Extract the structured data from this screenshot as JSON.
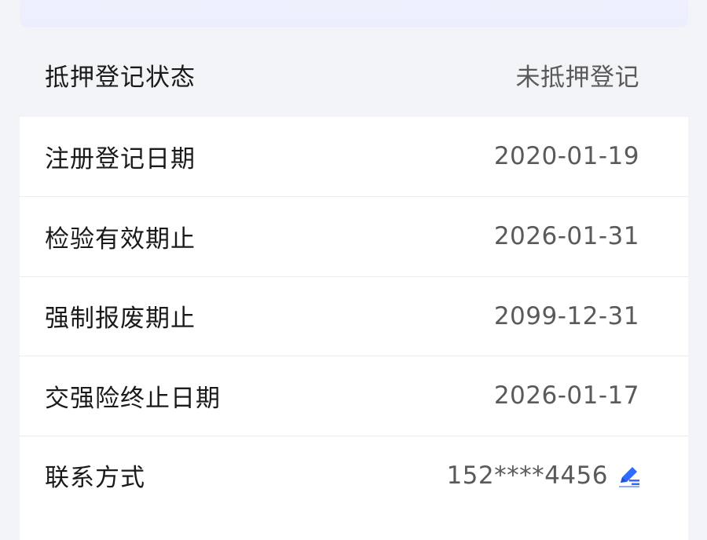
{
  "rows": [
    {
      "label": "抵押登记状态",
      "value": "未抵押登记"
    },
    {
      "label": "注册登记日期",
      "value": "2020-01-19"
    },
    {
      "label": "检验有效期止",
      "value": "2026-01-31"
    },
    {
      "label": "强制报废期止",
      "value": "2099-12-31"
    },
    {
      "label": "交强险终止日期",
      "value": "2026-01-17"
    },
    {
      "label": "联系方式",
      "value": "152****4456",
      "icon": "edit-icon"
    }
  ],
  "colors": {
    "accent": "#2f6bff",
    "background": "#f3f4f7",
    "card": "#ffffff",
    "text": "#1a1a1a",
    "value_text": "#5a5a5a"
  }
}
